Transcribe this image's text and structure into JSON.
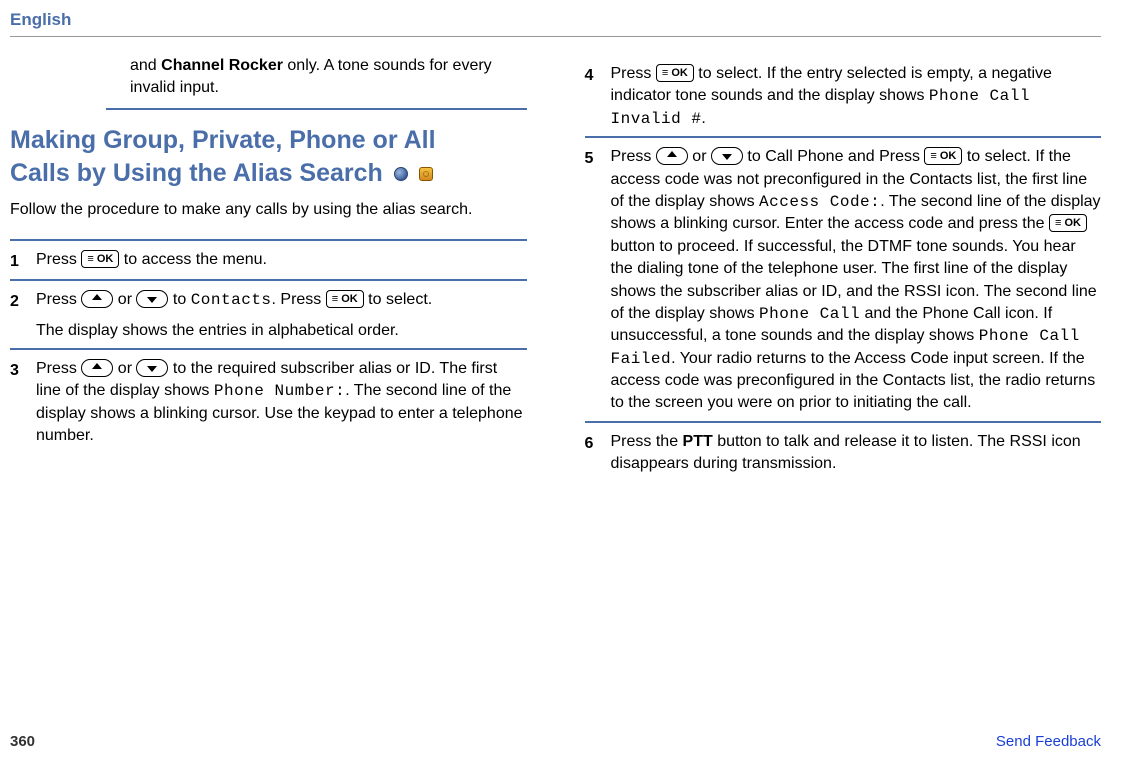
{
  "header": {
    "language": "English"
  },
  "prev_step": {
    "part1": "and ",
    "bold": "Channel Rocker",
    "part2": " only. A tone sounds for every invalid input."
  },
  "section": {
    "title_line1": "Making Group, Private, Phone or All",
    "title_line2": "Calls by Using the Alias Search",
    "intro": "Follow the procedure to make any calls by using the alias search."
  },
  "steps": {
    "s1": {
      "num": "1",
      "t1": "Press ",
      "t2": " to access the menu."
    },
    "s2": {
      "num": "2",
      "t1": "Press ",
      "t2": " or ",
      "t3": " to ",
      "mono1": "Contacts",
      "t4": ". Press ",
      "t5": " to select.",
      "note": "The display shows the entries in alphabetical order."
    },
    "s3": {
      "num": "3",
      "t1": "Press ",
      "t2": " or ",
      "t3": " to the required subscriber alias or ID. The first line of the display shows ",
      "mono1": "Phone Number:",
      "t4": ". The second line of the display shows a blinking cursor. Use the keypad to enter a telephone number."
    },
    "s4": {
      "num": "4",
      "t1": "Press ",
      "t2": " to select. If the entry selected is empty, a negative indicator tone sounds and the display shows ",
      "mono1": "Phone Call Invalid #",
      "t3": "."
    },
    "s5": {
      "num": "5",
      "t1": "Press ",
      "t2": " or ",
      "t3": " to Call Phone and Press ",
      "t4": " to select. If the access code was not preconfigured in the Contacts list, the first line of the display shows ",
      "mono1": "Access Code:",
      "t5": ". The second line of the display shows a blinking cursor. Enter the access code and press the ",
      "t6": " button to proceed. If successful, the DTMF tone sounds. You hear the dialing tone of the telephone user. The first line of the display shows the subscriber alias or ID, and the RSSI icon. The second line of the display shows ",
      "mono2": "Phone Call",
      "t7": " and the Phone Call icon. If unsuccessful, a tone sounds and the display shows ",
      "mono3": "Phone Call Failed",
      "t8": ". Your radio returns to the Access Code input screen. If the access code was preconfigured in the Contacts list, the radio returns to the screen you were on prior to initiating the call."
    },
    "s6": {
      "num": "6",
      "t1": "Press the ",
      "bold1": "PTT",
      "t2": " button to talk and release it to listen. The RSSI icon disappears during transmission."
    }
  },
  "footer": {
    "page": "360",
    "feedback": "Send Feedback"
  }
}
